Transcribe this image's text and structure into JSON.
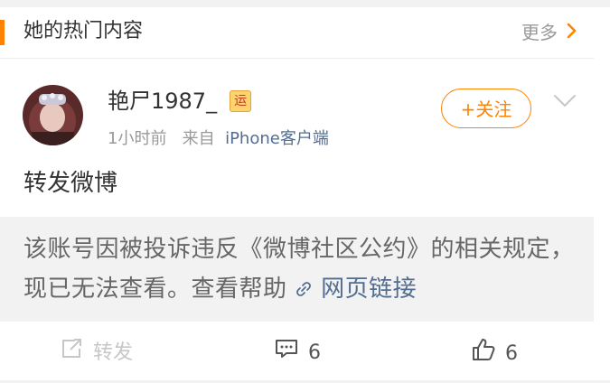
{
  "section": {
    "title": "她的热门内容",
    "more_label": "更多"
  },
  "post": {
    "username": "艳尸1987_",
    "badge_text": "运",
    "time": "1小时前",
    "from_label": "来自",
    "source": "iPhone客户端",
    "follow_label": "+关注",
    "text": "转发微博"
  },
  "retweet": {
    "notice_text": "该账号因被投诉违反《微博社区公约》的相关规定，现已无法查看。",
    "help_label": "查看帮助",
    "web_link_label": "网页链接"
  },
  "actions": {
    "repost_label": "转发",
    "comment_count": "6",
    "like_count": "6"
  },
  "colors": {
    "accent": "#ff8200",
    "link": "#526d91",
    "text": "#333333",
    "muted": "#999999"
  }
}
